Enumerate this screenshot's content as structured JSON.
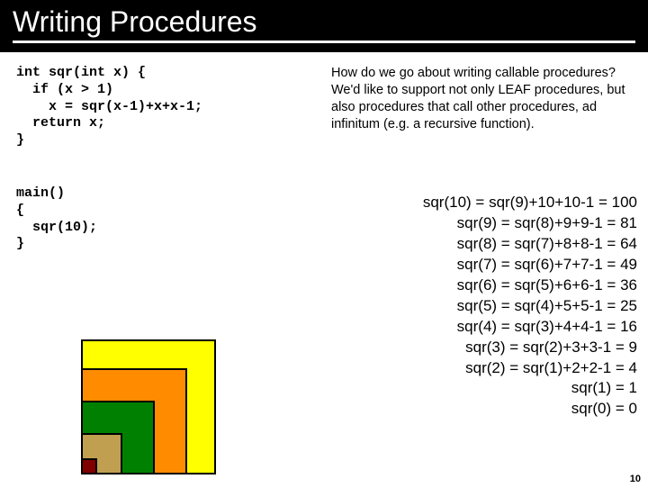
{
  "title": "Writing Procedures",
  "code": {
    "sqr": "int sqr(int x) {\n  if (x > 1)\n    x = sqr(x-1)+x+x-1;\n  return x;\n}",
    "main": "main()\n{\n  sqr(10);\n}"
  },
  "description": "How do we go about writing callable procedures? We'd like to support not only LEAF procedures, but also procedures that call other procedures, ad infinitum (e.g. a recursive function).",
  "calculations": [
    "sqr(10) = sqr(9)+10+10-1 = 100",
    "sqr(9) = sqr(8)+9+9-1 = 81",
    "sqr(8) = sqr(7)+8+8-1 = 64",
    "sqr(7) = sqr(6)+7+7-1 = 49",
    "sqr(6) = sqr(5)+6+6-1 = 36",
    "sqr(5) = sqr(4)+5+5-1 = 25",
    "sqr(4) = sqr(3)+4+4-1 = 16",
    "sqr(3) = sqr(2)+3+3-1 = 9",
    "sqr(2) = sqr(1)+2+2-1 = 4",
    "sqr(1) = 1",
    "sqr(0) = 0"
  ],
  "page_number": "10",
  "colors": {
    "yellow": "#ffff00",
    "orange": "#ff8c00",
    "green": "#008000",
    "tan": "#c0a050",
    "darkred": "#800000"
  }
}
